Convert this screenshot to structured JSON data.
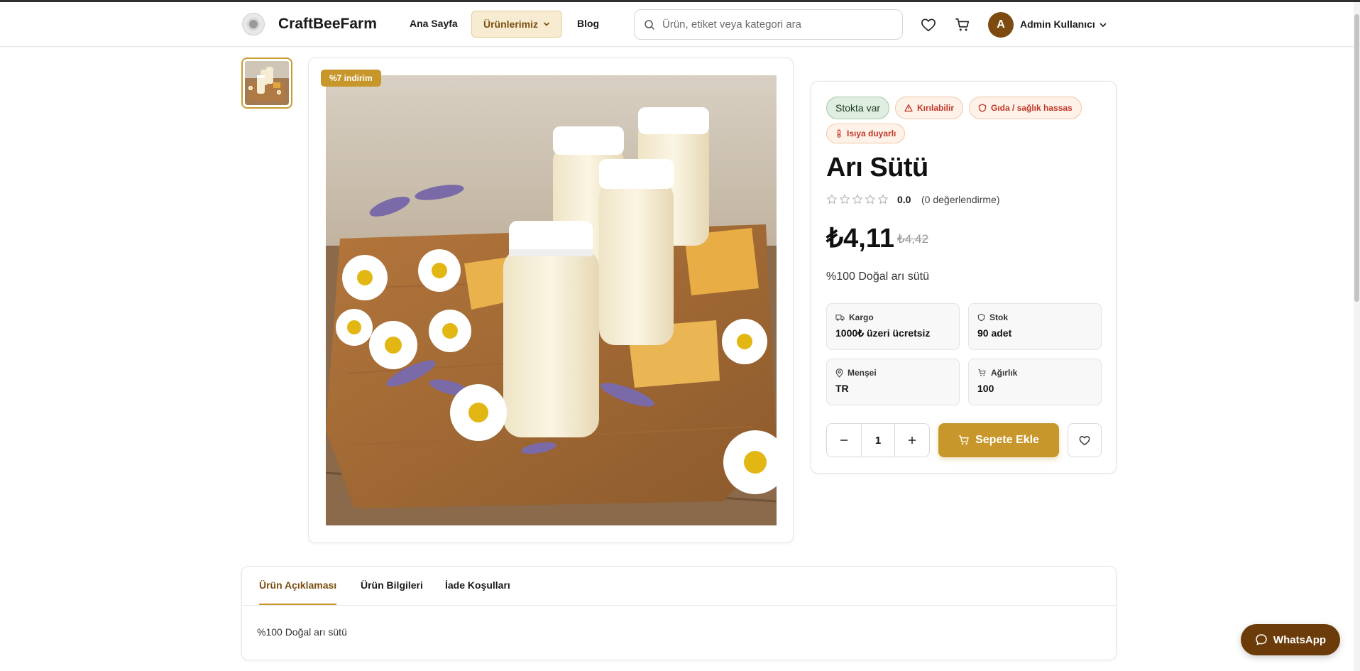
{
  "header": {
    "brand_name": "CraftBeeFarm",
    "nav": {
      "home": "Ana Sayfa",
      "products": "Ürünlerimiz",
      "blog": "Blog"
    },
    "search_placeholder": "Ürün, etiket veya kategori ara",
    "user": {
      "initial": "A",
      "name": "Admin Kullanıcı"
    }
  },
  "gallery": {
    "discount_badge": "%7 indirim"
  },
  "product": {
    "badges": {
      "stock": "Stokta var",
      "fragile": "Kırılabilir",
      "food": "Gıda / sağlık hassas",
      "heat": "Isıya duyarlı"
    },
    "title": "Arı Sütü",
    "rating": {
      "value": "0.0",
      "count_text": "(0 değerlendirme)",
      "stars_filled": 0,
      "stars_total": 5
    },
    "price": "₺4,11",
    "old_price": "₺4,42",
    "short_description": "%100 Doğal arı sütü",
    "specs": {
      "cargo_label": "Kargo",
      "cargo_value": "1000₺ üzeri ücretsiz",
      "stock_label": "Stok",
      "stock_value": "90 adet",
      "origin_label": "Menşei",
      "origin_value": "TR",
      "weight_label": "Ağırlık",
      "weight_value": "100"
    },
    "quantity": "1",
    "add_to_cart": "Sepete Ekle"
  },
  "tabs": {
    "items": [
      "Ürün Açıklaması",
      "Ürün Bilgileri",
      "İade Koşulları"
    ],
    "active_index": 0,
    "content": "%100 Doğal arı sütü"
  },
  "whatsapp_label": "WhatsApp",
  "colors": {
    "accent": "#c8972b",
    "brand_dark": "#7d4a10",
    "whatsapp_bg": "#6b3c0a"
  }
}
